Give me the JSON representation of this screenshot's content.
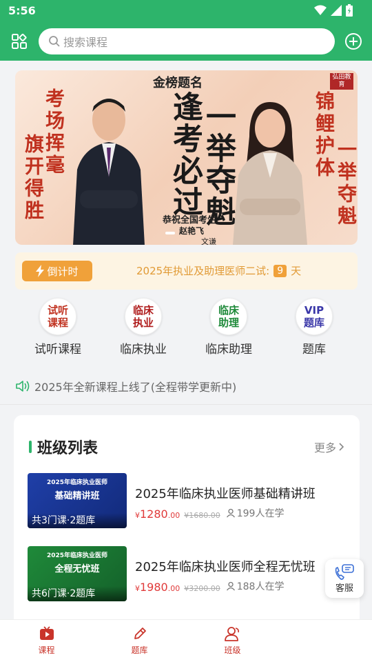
{
  "status_bar": {
    "time": "5:56"
  },
  "header": {
    "search_placeholder": "搜索课程"
  },
  "banner": {
    "top_script": "金榜题名",
    "left_calligraphy_1": "考场挥毫",
    "left_calligraphy_2": "旗开得胜",
    "main_line_1": "逢考必过",
    "main_line_2": "一举夺魁",
    "caption": "恭祝全国考生",
    "signature_1": "赵艳飞",
    "signature_2": "文谦",
    "right_calligraphy_1": "锦鲤护体",
    "right_calligraphy_2": "一举夺魁",
    "logo_text": "弘田教育"
  },
  "countdown": {
    "badge": "倒计时",
    "text_prefix": "2025年执业及助理医师二试:",
    "days": "9",
    "text_suffix": "天"
  },
  "quick_links": [
    {
      "icon_text": "试听课程",
      "label": "试听课程",
      "color": "#c0311f"
    },
    {
      "icon_text": "临床执业",
      "label": "临床执业",
      "color": "#b01e1e"
    },
    {
      "icon_text": "临床助理",
      "label": "临床助理",
      "color": "#1f8a3a"
    },
    {
      "icon_text": "VIP题库",
      "label": "题库",
      "color": "#3a37a8"
    }
  ],
  "notice": {
    "text": "2025年全新课程上线了(全程带学更新中)"
  },
  "class_list": {
    "title": "班级列表",
    "more": "更多",
    "courses": [
      {
        "thumb_line_1": "2025年临床执业医师",
        "thumb_line_2": "基础精讲班",
        "thumb_badge": "共3门课·2题库",
        "name": "2025年临床执业医师基础精讲班",
        "price_currency": "¥",
        "price_int": "1280",
        "price_dec": ".00",
        "old_price": "¥1680.00",
        "students": "199人在学",
        "thumb_color": "#1f3fa8"
      },
      {
        "thumb_line_1": "2025年临床执业医师",
        "thumb_line_2": "全程无忧班",
        "thumb_badge": "共6门课·2题库",
        "name": "2025年临床执业医师全程无忧班",
        "price_currency": "¥",
        "price_int": "1980",
        "price_dec": ".00",
        "old_price": "¥3200.00",
        "students": "188人在学",
        "thumb_color": "#1f8a3a"
      }
    ]
  },
  "floating_service": {
    "label": "客服"
  },
  "tabbar": [
    {
      "label": "课程",
      "icon": "play-tv-icon"
    },
    {
      "label": "题库",
      "icon": "pencil-icon"
    },
    {
      "label": "班级",
      "icon": "people-icon"
    }
  ],
  "colors": {
    "brand": "#2db46b",
    "price": "#e03a3a",
    "tab_active": "#c9342a",
    "countdown": "#f0a13a"
  }
}
